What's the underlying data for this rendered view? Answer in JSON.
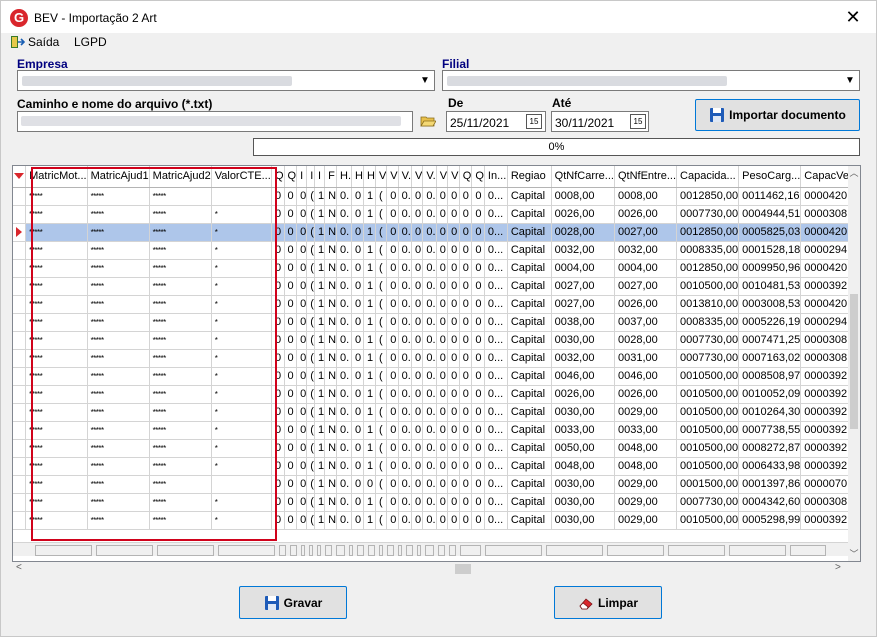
{
  "window": {
    "title": "BEV - Importação 2 Art",
    "close_label": "✕"
  },
  "menu": {
    "exit_label": "Saída",
    "lgpd_label": "LGPD"
  },
  "form": {
    "empresa_label": "Empresa",
    "filial_label": "Filial",
    "path_label": "Caminho e nome do arquivo (*.txt)",
    "de_label": "De",
    "ate_label": "Até",
    "date_from": "25/11/2021",
    "date_to": "30/11/2021",
    "cal_label": "15",
    "import_button": "Importar documento",
    "progress_text": "0%"
  },
  "grid": {
    "columns": [
      "MatricMot...",
      "MatricAjud1",
      "MatricAjud2",
      "ValorCTE...",
      "Q",
      "Q",
      "I",
      "I",
      "I",
      "F",
      "H.",
      "H",
      "H",
      "V",
      "V",
      "V.",
      "V",
      "V.",
      "V",
      "V",
      "Q",
      "Q",
      "In...",
      "Regiao",
      "QtNfCarre...",
      "QtNfEntre...",
      "Capacida...",
      "PesoCarg...",
      "CapacVe"
    ],
    "rows": [
      [
        "*****",
        "*****",
        "*****",
        "",
        "0",
        "0",
        "0",
        "(",
        "1",
        "N",
        "0.",
        "0",
        "1",
        "(",
        "0",
        "0.",
        "0",
        "0.",
        "0",
        "0",
        "0",
        "0",
        "0...",
        "Capital",
        "0008,00",
        "0008,00",
        "0012850,00",
        "0011462,16",
        "0000420"
      ],
      [
        "*****",
        "*****",
        "*****",
        "*",
        "0",
        "0",
        "0",
        "(",
        "1",
        "N",
        "0.",
        "0",
        "1",
        "(",
        "0",
        "0.",
        "0",
        "0.",
        "0",
        "0",
        "0",
        "0",
        "0...",
        "Capital",
        "0026,00",
        "0026,00",
        "0007730,00",
        "0004944,51",
        "0000308"
      ],
      [
        "*****",
        "*****",
        "*****",
        "*",
        "0",
        "0",
        "0",
        "(",
        "1",
        "N",
        "0.",
        "0",
        "1",
        "(",
        "0",
        "0.",
        "0",
        "0.",
        "0",
        "0",
        "0",
        "0",
        "0...",
        "Capital",
        "0028,00",
        "0027,00",
        "0012850,00",
        "0005825,03",
        "0000420"
      ],
      [
        "*****",
        "*****",
        "*****",
        "*",
        "0",
        "0",
        "0",
        "(",
        "1",
        "N",
        "0.",
        "0",
        "1",
        "(",
        "0",
        "0.",
        "0",
        "0.",
        "0",
        "0",
        "0",
        "0",
        "0...",
        "Capital",
        "0032,00",
        "0032,00",
        "0008335,00",
        "0001528,18",
        "0000294"
      ],
      [
        "*****",
        "*****",
        "*****",
        "*",
        "0",
        "0",
        "0",
        "(",
        "1",
        "N",
        "0.",
        "0",
        "1",
        "(",
        "0",
        "0.",
        "0",
        "0.",
        "0",
        "0",
        "0",
        "0",
        "0...",
        "Capital",
        "0004,00",
        "0004,00",
        "0012850,00",
        "0009950,96",
        "0000420"
      ],
      [
        "*****",
        "*****",
        "*****",
        "*",
        "0",
        "0",
        "0",
        "(",
        "1",
        "N",
        "0.",
        "0",
        "1",
        "(",
        "0",
        "0.",
        "0",
        "0.",
        "0",
        "0",
        "0",
        "0",
        "0...",
        "Capital",
        "0027,00",
        "0027,00",
        "0010500,00",
        "0010481,53",
        "0000392"
      ],
      [
        "*****",
        "*****",
        "*****",
        "*",
        "0",
        "0",
        "0",
        "(",
        "1",
        "N",
        "0.",
        "0",
        "1",
        "(",
        "0",
        "0.",
        "0",
        "0.",
        "0",
        "0",
        "0",
        "0",
        "0...",
        "Capital",
        "0027,00",
        "0026,00",
        "0013810,00",
        "0003008,53",
        "0000420"
      ],
      [
        "*****",
        "*****",
        "*****",
        "*",
        "0",
        "0",
        "0",
        "(",
        "1",
        "N",
        "0.",
        "0",
        "1",
        "(",
        "0",
        "0.",
        "0",
        "0.",
        "0",
        "0",
        "0",
        "0",
        "0...",
        "Capital",
        "0038,00",
        "0037,00",
        "0008335,00",
        "0005226,19",
        "0000294"
      ],
      [
        "*****",
        "*****",
        "*****",
        "*",
        "0",
        "0",
        "0",
        "(",
        "1",
        "N",
        "0.",
        "0",
        "1",
        "(",
        "0",
        "0.",
        "0",
        "0.",
        "0",
        "0",
        "0",
        "0",
        "0...",
        "Capital",
        "0030,00",
        "0028,00",
        "0007730,00",
        "0007471,25",
        "0000308"
      ],
      [
        "*****",
        "*****",
        "*****",
        "*",
        "0",
        "0",
        "0",
        "(",
        "1",
        "N",
        "0.",
        "0",
        "1",
        "(",
        "0",
        "0.",
        "0",
        "0.",
        "0",
        "0",
        "0",
        "0",
        "0...",
        "Capital",
        "0032,00",
        "0031,00",
        "0007730,00",
        "0007163,02",
        "0000308"
      ],
      [
        "*****",
        "*****",
        "*****",
        "*",
        "0",
        "0",
        "0",
        "(",
        "1",
        "N",
        "0.",
        "0",
        "1",
        "(",
        "0",
        "0.",
        "0",
        "0.",
        "0",
        "0",
        "0",
        "0",
        "0...",
        "Capital",
        "0046,00",
        "0046,00",
        "0010500,00",
        "0008508,97",
        "0000392"
      ],
      [
        "*****",
        "*****",
        "*****",
        "*",
        "0",
        "0",
        "0",
        "(",
        "1",
        "N",
        "0.",
        "0",
        "1",
        "(",
        "0",
        "0.",
        "0",
        "0.",
        "0",
        "0",
        "0",
        "0",
        "0...",
        "Capital",
        "0026,00",
        "0026,00",
        "0010500,00",
        "0010052,09",
        "0000392"
      ],
      [
        "*****",
        "*****",
        "*****",
        "*",
        "0",
        "0",
        "0",
        "(",
        "1",
        "N",
        "0.",
        "0",
        "1",
        "(",
        "0",
        "0.",
        "0",
        "0.",
        "0",
        "0",
        "0",
        "0",
        "0...",
        "Capital",
        "0030,00",
        "0029,00",
        "0010500,00",
        "0010264,30",
        "0000392"
      ],
      [
        "*****",
        "*****",
        "*****",
        "*",
        "0",
        "0",
        "0",
        "(",
        "1",
        "N",
        "0.",
        "0",
        "1",
        "(",
        "0",
        "0.",
        "0",
        "0.",
        "0",
        "0",
        "0",
        "0",
        "0...",
        "Capital",
        "0033,00",
        "0033,00",
        "0010500,00",
        "0007738,55",
        "0000392"
      ],
      [
        "*****",
        "*****",
        "*****",
        "*",
        "0",
        "0",
        "0",
        "(",
        "1",
        "N",
        "0.",
        "0",
        "1",
        "(",
        "0",
        "0.",
        "0",
        "0.",
        "0",
        "0",
        "0",
        "0",
        "0...",
        "Capital",
        "0050,00",
        "0048,00",
        "0010500,00",
        "0008272,87",
        "0000392"
      ],
      [
        "*****",
        "*****",
        "*****",
        "*",
        "0",
        "0",
        "0",
        "(",
        "1",
        "N",
        "0.",
        "0",
        "1",
        "(",
        "0",
        "0.",
        "0",
        "0.",
        "0",
        "0",
        "0",
        "0",
        "0...",
        "Capital",
        "0048,00",
        "0048,00",
        "0010500,00",
        "0006433,98",
        "0000392"
      ],
      [
        "*****",
        "*****",
        "*****",
        "",
        "0",
        "0",
        "0",
        "(",
        "1",
        "N",
        "0.",
        "0",
        "0",
        "(",
        "0",
        "0.",
        "0",
        "0.",
        "0",
        "0",
        "0",
        "0",
        "0...",
        "Capital",
        "0030,00",
        "0029,00",
        "0001500,00",
        "0001397,86",
        "0000070"
      ],
      [
        "*****",
        "*****",
        "*****",
        "*",
        "0",
        "0",
        "0",
        "(",
        "1",
        "N",
        "0.",
        "0",
        "1",
        "(",
        "0",
        "0.",
        "0",
        "0.",
        "0",
        "0",
        "0",
        "0",
        "0...",
        "Capital",
        "0030,00",
        "0029,00",
        "0007730,00",
        "0004342,60",
        "0000308"
      ],
      [
        "*****",
        "*****",
        "*****",
        "*",
        "0",
        "0",
        "0",
        "(",
        "1",
        "N",
        "0.",
        "0",
        "1",
        "(",
        "0",
        "0.",
        "0",
        "0.",
        "0",
        "0",
        "0",
        "0",
        "0...",
        "Capital",
        "0030,00",
        "0029,00",
        "0010500,00",
        "0005298,99",
        "0000392"
      ]
    ],
    "selected_row": 2
  },
  "buttons": {
    "save": "Gravar",
    "clear": "Limpar"
  },
  "colors": {
    "accent": "#0078d7",
    "selection": "#aec6ea",
    "highlight_box": "#d0021b",
    "indicator": "#d9262c"
  }
}
